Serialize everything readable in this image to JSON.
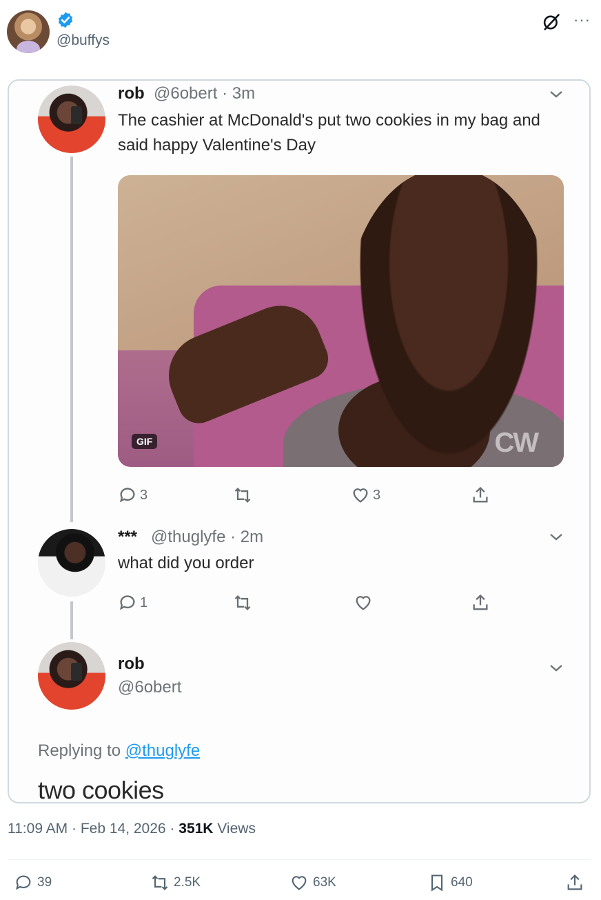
{
  "post": {
    "handle": "@buffys",
    "timestamp": "11:09 AM · Feb 14, 2026 · ",
    "views_count": "351K",
    "views_label": " Views",
    "actions": {
      "replies": "39",
      "reposts": "2.5K",
      "likes": "63K",
      "bookmarks": "640"
    }
  },
  "screenshot": {
    "tweet1": {
      "name": "rob",
      "meta": "@6obert · 3m",
      "text": "The cashier at McDonald's put two cookies in my bag and said happy Valentine's Day",
      "gif_badge": "GIF",
      "gif_watermark": "CW",
      "replies": "3",
      "likes": "3"
    },
    "tweet2": {
      "name": "***",
      "meta": "@thuglyfe · 2m",
      "text": "what did you order",
      "replies": "1"
    },
    "tweet3": {
      "name": "rob",
      "handle": "@6obert",
      "replying_prefix": "Replying to ",
      "replying_to": "@thuglyfe",
      "text": "two cookies"
    }
  },
  "colors": {
    "accent": "#1d9bf0",
    "verified": "#1d9bf0",
    "muted": "#536471"
  },
  "icons": [
    "verified-badge-icon",
    "grok-icon",
    "more-icon",
    "chevron-down-icon",
    "reply-icon",
    "repost-icon",
    "like-icon",
    "share-icon",
    "bookmark-icon"
  ]
}
